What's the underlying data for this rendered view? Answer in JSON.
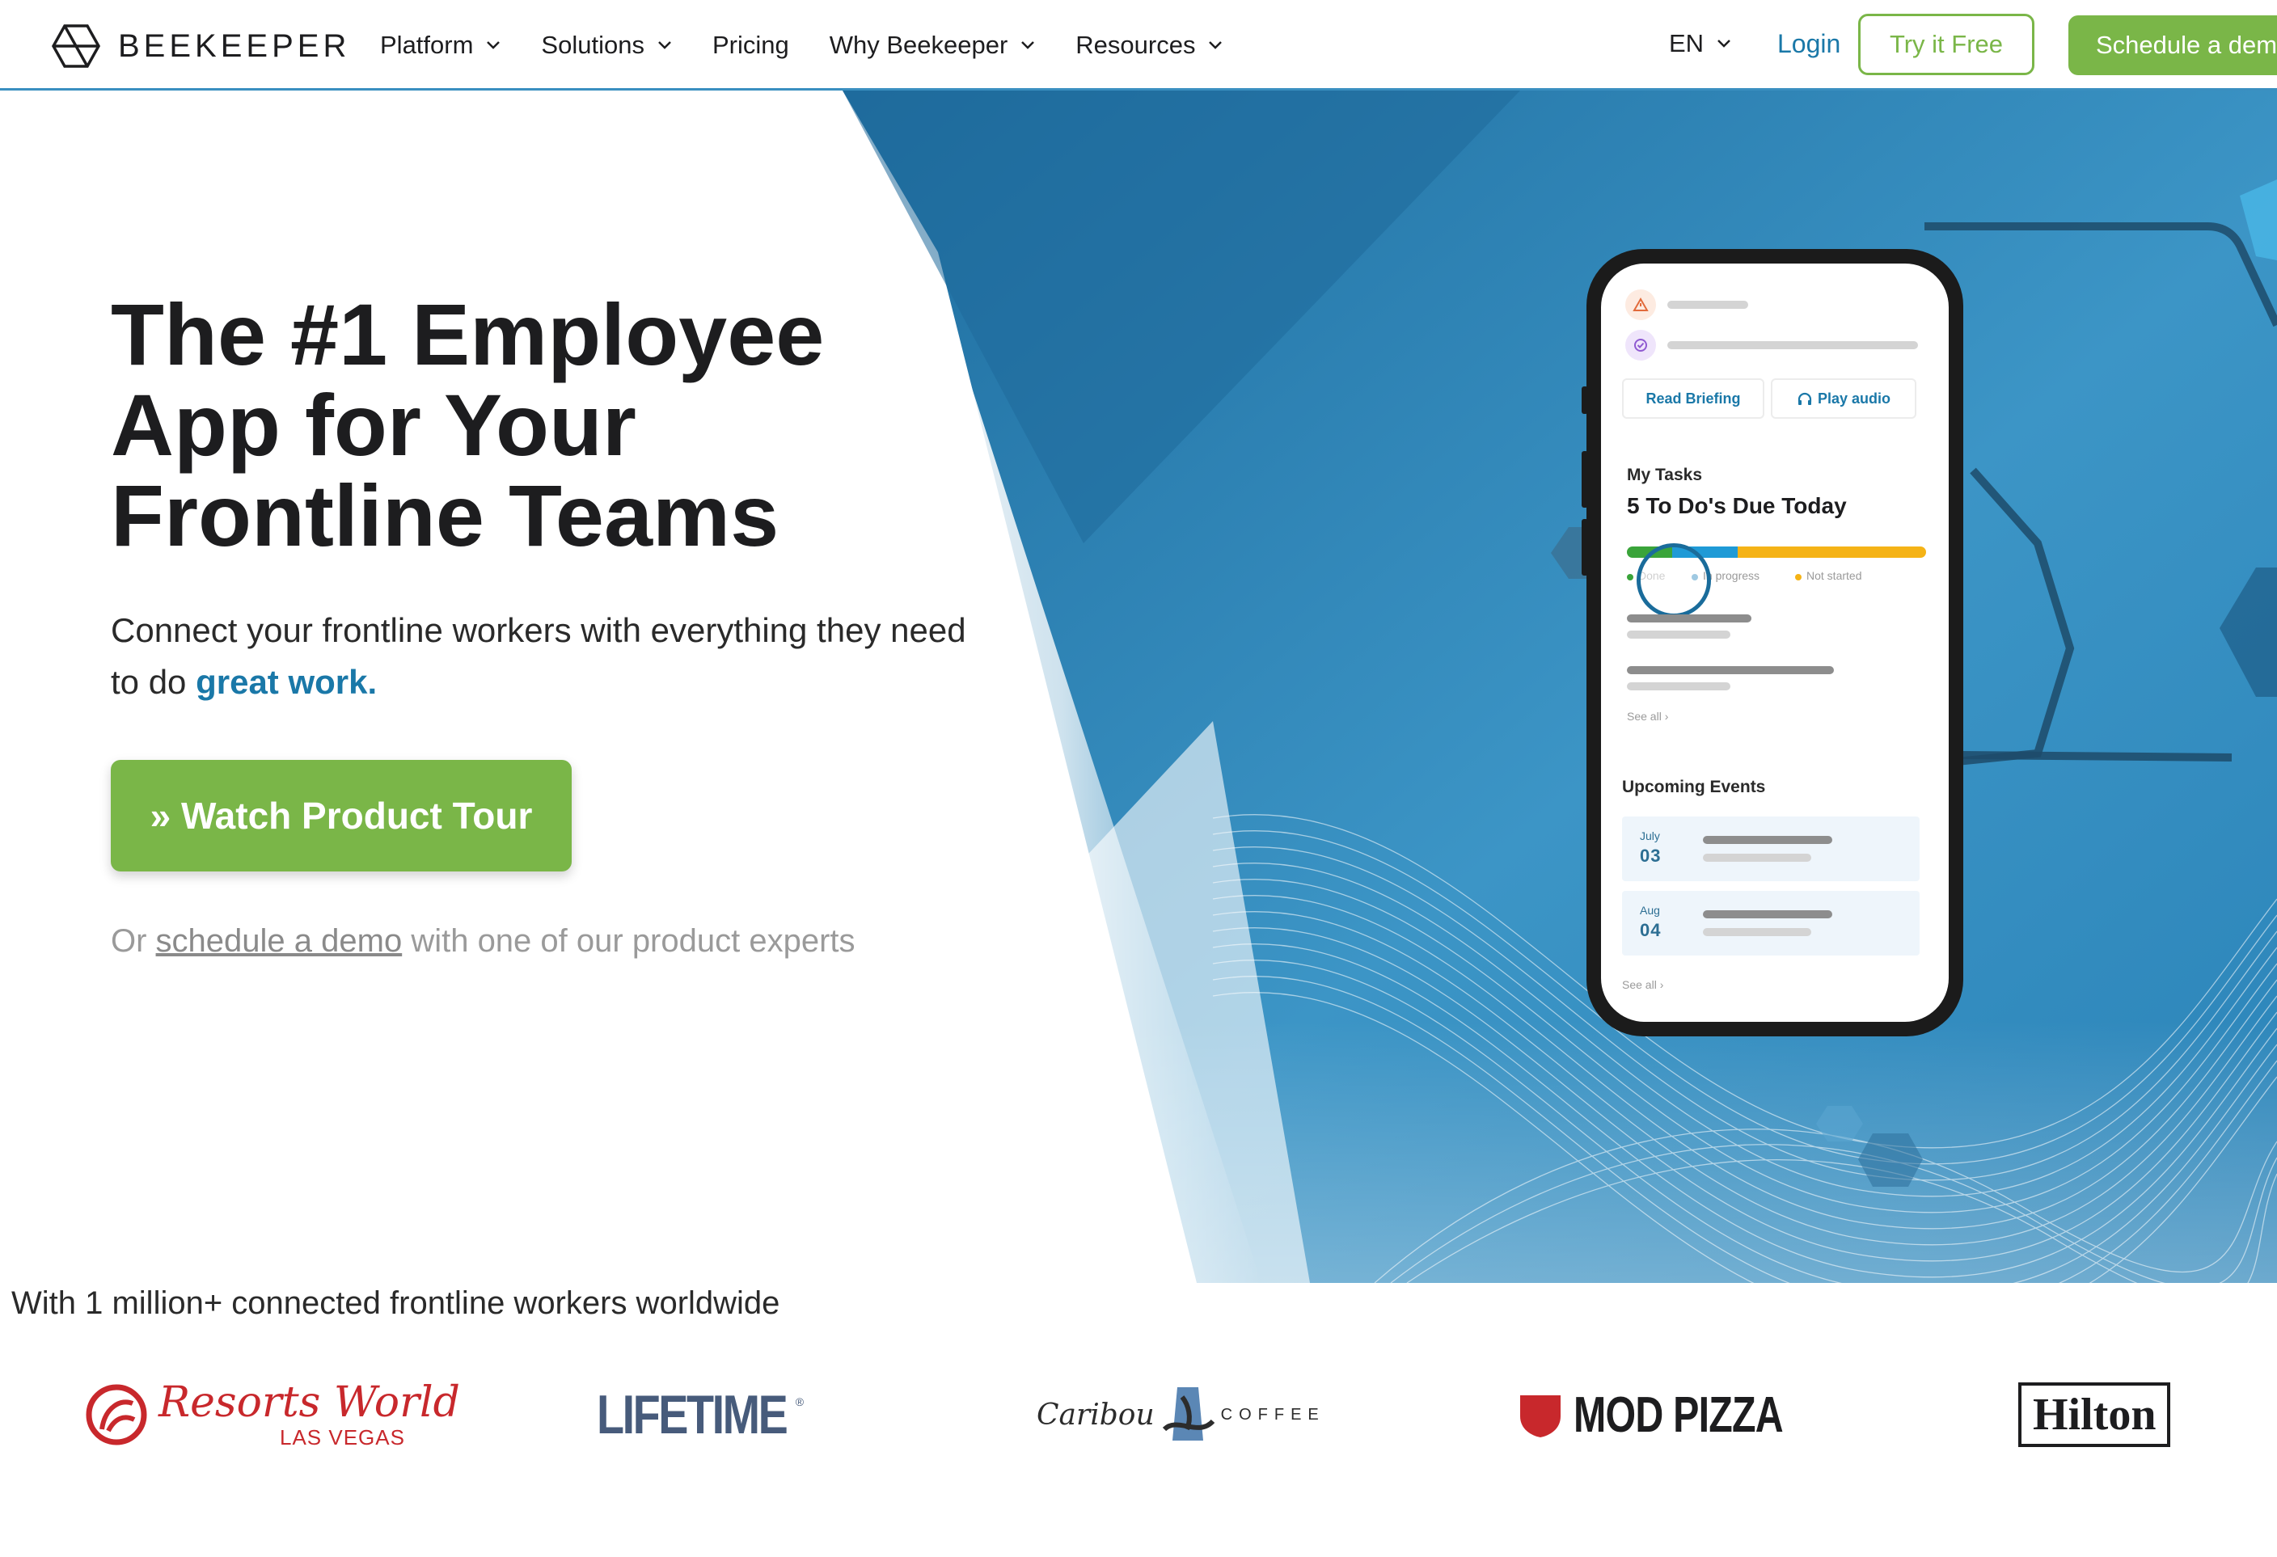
{
  "nav": {
    "brand": "BEEKEEPER",
    "menu": [
      {
        "label": "Platform",
        "has_dropdown": true
      },
      {
        "label": "Solutions",
        "has_dropdown": true
      },
      {
        "label": "Pricing",
        "has_dropdown": false
      },
      {
        "label": "Why Beekeeper",
        "has_dropdown": true
      },
      {
        "label": "Resources",
        "has_dropdown": true
      }
    ],
    "language": "EN",
    "login": "Login",
    "try_free": "Try it Free",
    "schedule_demo": "Schedule a demo"
  },
  "hero": {
    "headline_lines": [
      "The #1 Employee",
      "App for Your",
      "Frontline Teams"
    ],
    "sub_lead": "Connect your frontline workers with everything they need to do ",
    "sub_highlight": "great work.",
    "cta": "» Watch Product Tour",
    "or_prefix": "Or ",
    "or_link": "schedule a demo",
    "or_suffix": " with one of our product experts"
  },
  "phone": {
    "read_briefing": "Read Briefing",
    "play_audio": "Play audio",
    "tasks_label": "My Tasks",
    "tasks_title": "5 To Do's Due Today",
    "legend": [
      "Done",
      "In progress",
      "Not started"
    ],
    "see_all": "See all",
    "events_label": "Upcoming Events",
    "events": [
      {
        "month": "July",
        "day": "03"
      },
      {
        "month": "Aug",
        "day": "04"
      }
    ],
    "progress": {
      "done": 0.15,
      "in_progress": 0.22,
      "not_started": 0.63
    }
  },
  "colors": {
    "green": "#7ab648",
    "blue_link": "#1a78a8",
    "hero_blue": "#2678a8",
    "not_started": "#f5b316",
    "in_progress": "#1f9ad6",
    "done": "#3aa43a"
  },
  "social_proof": {
    "headline": "With 1 million+ connected frontline workers worldwide",
    "logos": [
      {
        "name": "Resorts World",
        "sub": "LAS VEGAS"
      },
      {
        "name": "LIFETIME"
      },
      {
        "name": "Caribou",
        "sub": "COFFEE"
      },
      {
        "name": "MOD PIZZA"
      },
      {
        "name": "Hilton"
      }
    ]
  }
}
